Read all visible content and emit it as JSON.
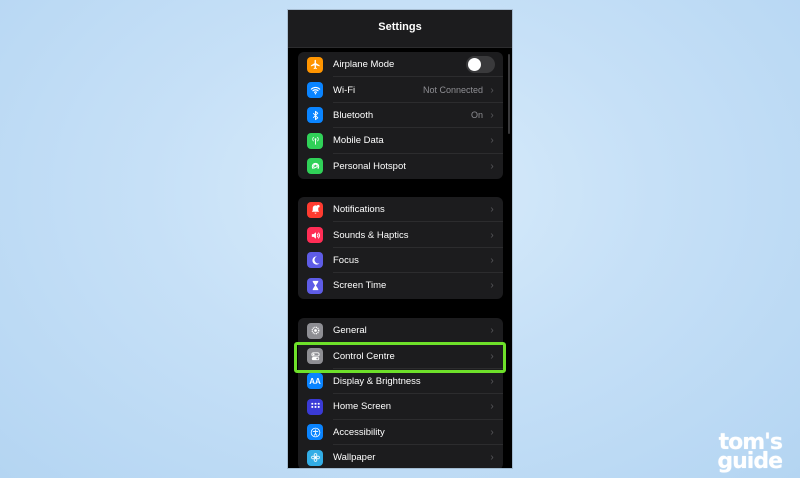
{
  "navbar": {
    "title": "Settings"
  },
  "group1": [
    {
      "label": "Airplane Mode",
      "icon": "airplane-icon",
      "color": "#ff9500",
      "toggle": false
    },
    {
      "label": "Wi-Fi",
      "icon": "wifi-icon",
      "color": "#0a84ff",
      "value": "Not Connected"
    },
    {
      "label": "Bluetooth",
      "icon": "bluetooth-icon",
      "color": "#0a84ff",
      "value": "On"
    },
    {
      "label": "Mobile Data",
      "icon": "antenna-icon",
      "color": "#30d158"
    },
    {
      "label": "Personal Hotspot",
      "icon": "hotspot-icon",
      "color": "#30d158"
    }
  ],
  "group2": [
    {
      "label": "Notifications",
      "icon": "bell-icon",
      "color": "#ff3b30"
    },
    {
      "label": "Sounds & Haptics",
      "icon": "speaker-icon",
      "color": "#ff2d55"
    },
    {
      "label": "Focus",
      "icon": "moon-icon",
      "color": "#5e5ce6"
    },
    {
      "label": "Screen Time",
      "icon": "hourglass-icon",
      "color": "#5e5ce6"
    }
  ],
  "group3": [
    {
      "label": "General",
      "icon": "gear-icon",
      "color": "#8e8e93"
    },
    {
      "label": "Control Centre",
      "icon": "switches-icon",
      "color": "#8e8e93"
    },
    {
      "label": "Display & Brightness",
      "icon": "text-size-icon",
      "color": "#0a84ff",
      "glyph": "AA"
    },
    {
      "label": "Home Screen",
      "icon": "app-grid-icon",
      "color": "#3a3ad6"
    },
    {
      "label": "Accessibility",
      "icon": "accessibility-icon",
      "color": "#0a84ff"
    },
    {
      "label": "Wallpaper",
      "icon": "flower-icon",
      "color": "#32ade6"
    }
  ],
  "highlight": {
    "target": "Control Centre",
    "color": "#6ee02a"
  },
  "watermark": {
    "line1": "tom's",
    "line2": "guide"
  }
}
